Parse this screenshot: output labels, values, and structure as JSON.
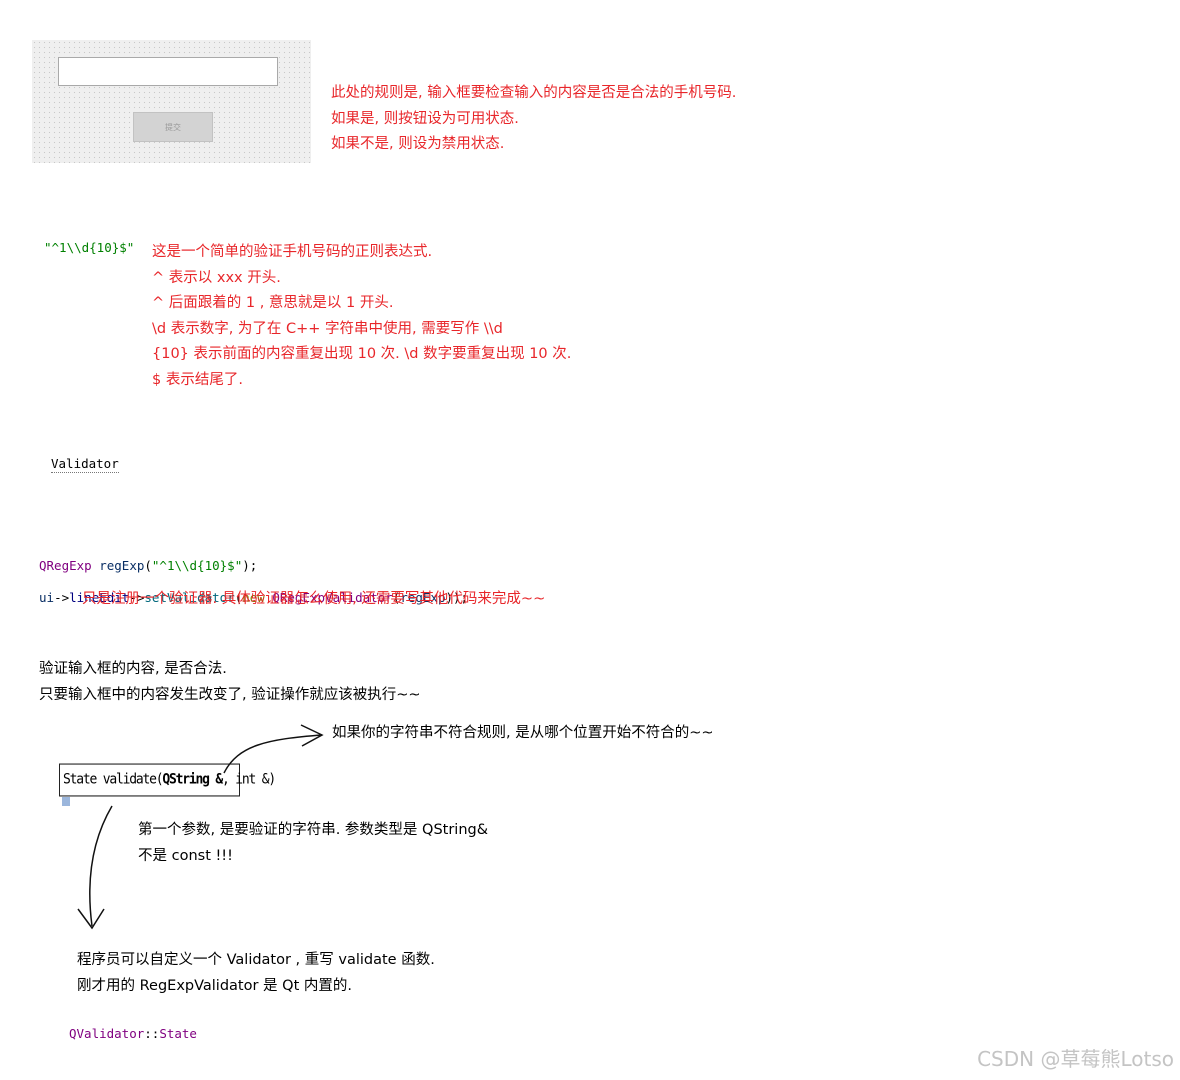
{
  "designer_preview": {
    "submit_button_label": "提交"
  },
  "notes": {
    "rule": [
      "此处的规则是, 输入框要检查输入的内容是否是合法的手机号码.",
      "如果是, 则按钮设为可用状态.",
      "如果不是, 则设为禁用状态."
    ],
    "regex_literal": "\"^1\\\\d{10}$\"",
    "regex_explain": [
      "这是一个简单的验证手机号码的正则表达式.",
      "^ 表示以 xxx 开头.",
      "^ 后面跟着的 1 , 意思就是以 1 开头.",
      "\\d 表示数字, 为了在 C++ 字符串中使用, 需要写作 \\\\d",
      "{10} 表示前面的内容重复出现 10 次. \\d 数字要重复出现 10 次.",
      "$ 表示结尾了."
    ],
    "validator_word": "Validator",
    "code": {
      "l1_type": "QRegExp",
      "l1_var": "regExp",
      "l1_open": "(",
      "l1_str": "\"^1\\\\d{10}$\"",
      "l1_close": ");",
      "l2_ui": "ui",
      "l2_arrow1": "->",
      "l2_lineedit": "lineEdit",
      "l2_arrow2": "->",
      "l2_fn": "setValidator",
      "l2_open": "(",
      "l2_new": "new",
      "l2_cls": "QRegExpValidator",
      "l2_arg_open": "(",
      "l2_arg": "regExp",
      "l2_close": "));"
    },
    "register_note": "只是注册一个验证器. 具体验证器怎么使用, 还需要写其他代码来完成~~",
    "validate_desc": [
      "验证输入框的内容, 是否合法.",
      "只要输入框中的内容发生改变了, 验证操作就应该被执行~~"
    ],
    "position_note": "如果你的字符串不符合规则, 是从哪个位置开始不符合的~~",
    "signature": {
      "state": "State validate(",
      "qstring": "QString &",
      "rest": ", int &)"
    },
    "first_param": [
      "第一个参数, 是要验证的字符串. 参数类型是 QString&",
      "不是 const !!!"
    ],
    "custom": [
      "程序员可以自定义一个 Validator , 重写 validate 函数.",
      "刚才用的 RegExpValidator 是 Qt 内置的."
    ],
    "state_code": {
      "cls": "QValidator",
      "sep": "::",
      "member": "State"
    }
  },
  "watermark": "CSDN @草莓熊Lotso",
  "colors": {
    "note_red": "#e8262a",
    "code_class": "#800080",
    "code_string": "#008000",
    "code_keyword": "#808000",
    "code_function": "#00677c"
  }
}
